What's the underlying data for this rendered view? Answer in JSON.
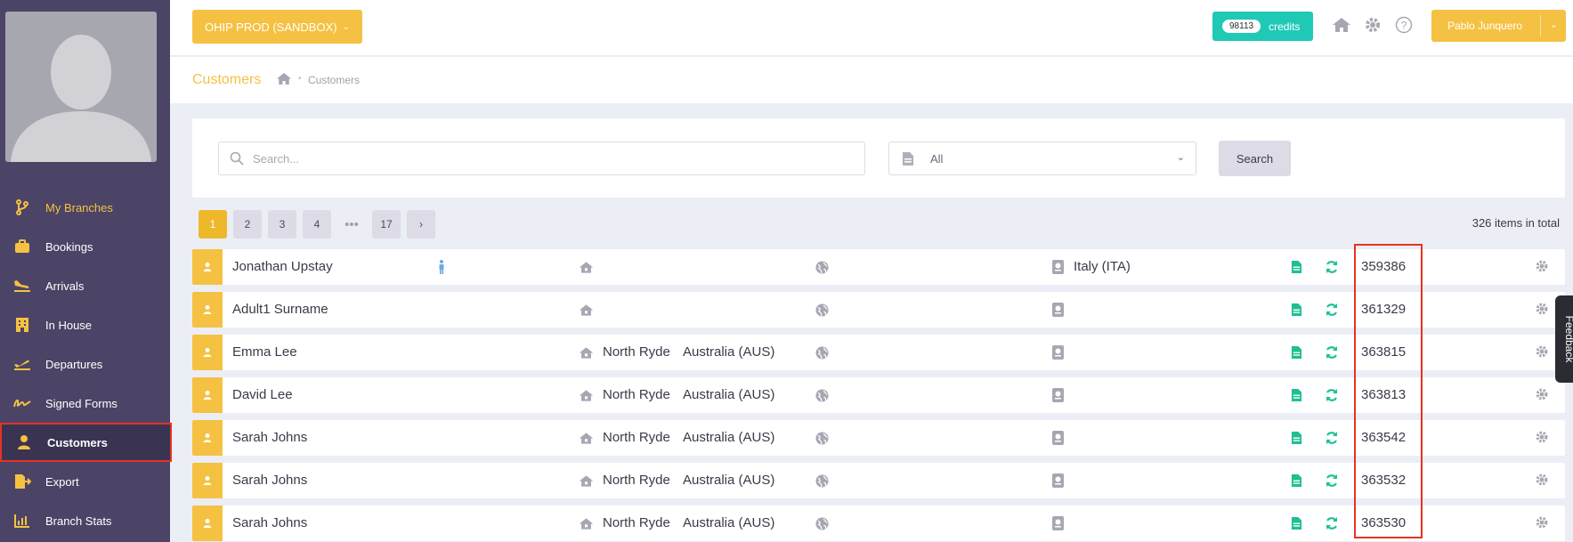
{
  "sidebar": {
    "items": [
      {
        "label": "My Branches",
        "icon": "branch-icon"
      },
      {
        "label": "Bookings",
        "icon": "briefcase-icon"
      },
      {
        "label": "Arrivals",
        "icon": "plane-landing-icon"
      },
      {
        "label": "In House",
        "icon": "building-icon"
      },
      {
        "label": "Departures",
        "icon": "plane-departure-icon"
      },
      {
        "label": "Signed Forms",
        "icon": "signature-icon"
      },
      {
        "label": "Customers",
        "icon": "user-icon"
      },
      {
        "label": "Export",
        "icon": "file-export-icon"
      },
      {
        "label": "Branch Stats",
        "icon": "chart-bar-icon"
      }
    ]
  },
  "topbar": {
    "env_label": "OHIP PROD (SANDBOX)",
    "credits_count": "98113",
    "credits_label": "credits",
    "user_name": "Pablo Junquero"
  },
  "breadcrumb": {
    "title": "Customers",
    "current": "Customers"
  },
  "search": {
    "placeholder": "Search...",
    "filter_value": "All",
    "button_label": "Search"
  },
  "pagination": {
    "pages": [
      "1",
      "2",
      "3",
      "4",
      "17"
    ],
    "current": "1",
    "total_label": "326 items in total"
  },
  "customers": [
    {
      "name": "Jonathan Upstay",
      "city": "",
      "country": "",
      "nationality": "Italy (ITA)",
      "id": "359386"
    },
    {
      "name": "Adult1 Surname",
      "city": "",
      "country": "",
      "nationality": "",
      "id": "361329"
    },
    {
      "name": "Emma Lee",
      "city": "North Ryde",
      "country": "Australia (AUS)",
      "nationality": "",
      "id": "363815"
    },
    {
      "name": "David Lee",
      "city": "North Ryde",
      "country": "Australia (AUS)",
      "nationality": "",
      "id": "363813"
    },
    {
      "name": "Sarah Johns",
      "city": "North Ryde",
      "country": "Australia (AUS)",
      "nationality": "",
      "id": "363542"
    },
    {
      "name": "Sarah Johns",
      "city": "North Ryde",
      "country": "Australia (AUS)",
      "nationality": "",
      "id": "363532"
    },
    {
      "name": "Sarah Johns",
      "city": "North Ryde",
      "country": "Australia (AUS)",
      "nationality": "",
      "id": "363530"
    }
  ],
  "feedback_label": "Feedback",
  "colors": {
    "accent": "#f5c142",
    "sidebar": "#4b4466",
    "teal": "#1fc9b6",
    "highlight": "#e53323"
  }
}
